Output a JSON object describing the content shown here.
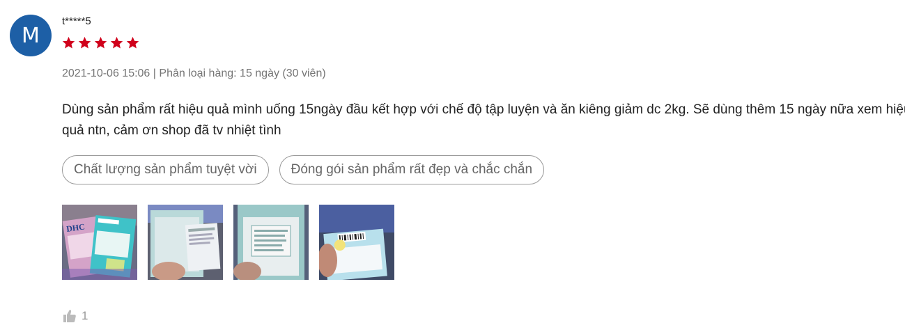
{
  "review": {
    "avatar_letter": "M",
    "avatar_color": "#1d5fa6",
    "username": "t*****5",
    "rating": 5,
    "star_color": "#d0011b",
    "date": "2021-10-06 15:06",
    "separator": "|",
    "variant": "Phân loại hàng: 15 ngày (30 viên)",
    "text": "Dùng sản phẩm rất hiệu quả mình uống 15ngày đầu kết hợp với chế độ tập luyện và ăn kiêng giảm dc 2kg. Sẽ dùng thêm 15 ngày nữa xem hiệu quả ntn, cảm ơn shop đã tv nhiệt tình",
    "tags": [
      "Chất lượng sản phẩm tuyệt vời",
      "Đóng gói sản phẩm rất đẹp và chắc chắn"
    ],
    "photo_labels": {
      "brand": "DHC"
    },
    "like_count": "1"
  }
}
